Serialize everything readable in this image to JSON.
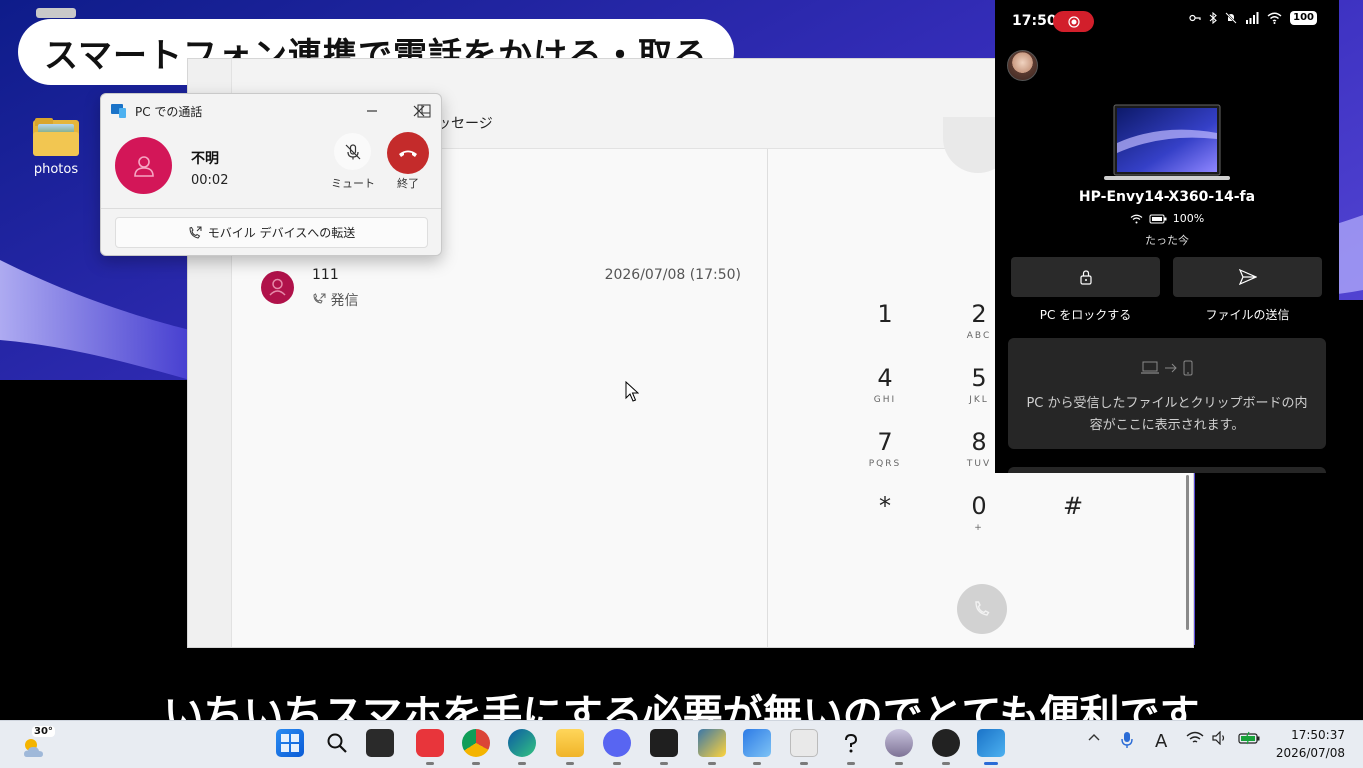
{
  "captions": {
    "top": "スマートフォン連携で電話をかける・取る",
    "bottom": "いちいちスマホを手にする必要が無いのでとても便利です"
  },
  "desktop": {
    "icons": [
      {
        "label": "photos",
        "icon": "folder-icon"
      }
    ]
  },
  "phone_link_window": {
    "tab_label": "ッセージ",
    "recent_call": {
      "number": "111",
      "direction": "発信",
      "datetime": "2026/07/08 (17:50)"
    },
    "dialpad": [
      {
        "digit": "1",
        "letters": ""
      },
      {
        "digit": "2",
        "letters": "ABC"
      },
      {
        "digit": "4",
        "letters": "GHI"
      },
      {
        "digit": "5",
        "letters": "JKL"
      },
      {
        "digit": "7",
        "letters": "PQRS"
      },
      {
        "digit": "8",
        "letters": "TUV"
      },
      {
        "digit": "*",
        "letters": ""
      },
      {
        "digit": "0",
        "letters": "+"
      },
      {
        "digit": "#",
        "letters": ""
      }
    ]
  },
  "call_popup": {
    "title": "PC での通話",
    "caller": "不明",
    "duration": "00:02",
    "mute_label": "ミュート",
    "end_label": "終了",
    "transfer_label": "モバイル デバイスへの転送"
  },
  "phone_panel": {
    "status_time": "17:50",
    "battery": "100",
    "device_name": "HP-Envy14-X360-14-fa",
    "device_battery": "100%",
    "last_synced": "たった今",
    "lock_label": "PC をロックする",
    "send_file_label": "ファイルの送信",
    "clipboard_text": "PC から受信したファイルとクリップボードの内容がここに表示されます。"
  },
  "taskbar": {
    "weather_temp": "30°",
    "time": "17:50:37",
    "date": "2026/07/08",
    "apps": [
      "start",
      "search",
      "terminal-dark",
      "vivaldi",
      "chrome",
      "edge",
      "file-explorer",
      "discord",
      "terminal",
      "python",
      "photos",
      "paint",
      "help",
      "anime",
      "obs",
      "phone-link"
    ]
  },
  "colors": {
    "accent_red": "#c42b2b",
    "avatar_pink": "#d31658",
    "record_red": "#d21f2b"
  }
}
